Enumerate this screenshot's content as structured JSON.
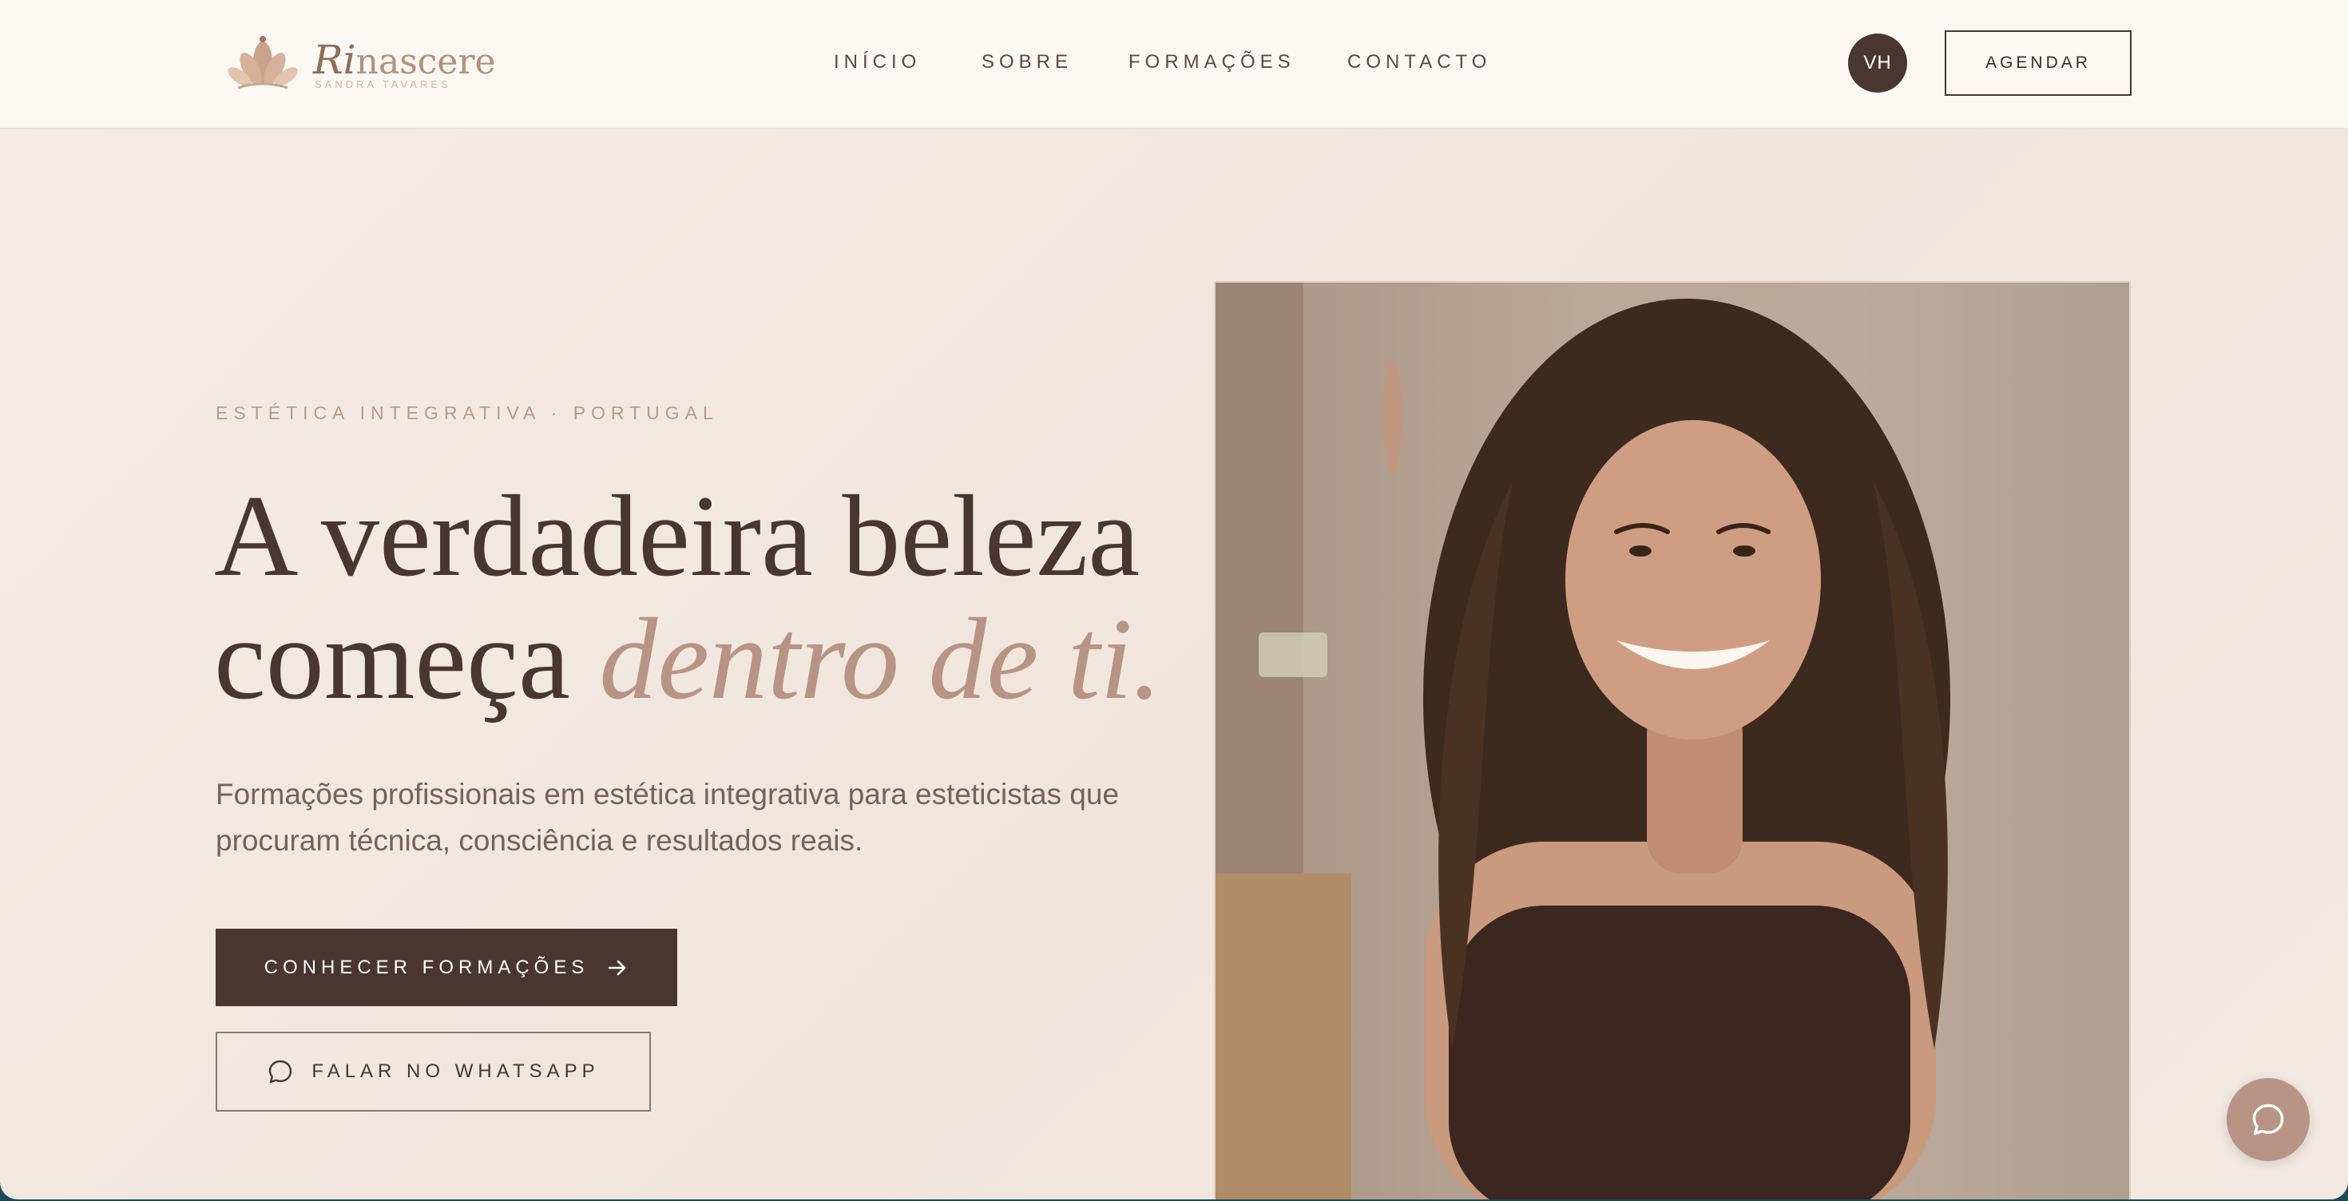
{
  "brand": {
    "logo_prefix": "Ri",
    "logo_suffix": "nascere",
    "logo_subtitle": "SANDRA TAVARES"
  },
  "nav": {
    "items": [
      "INÍCIO",
      "SOBRE",
      "FORMAÇÕES",
      "CONTACTO"
    ]
  },
  "header": {
    "avatar_initials": "VH",
    "cta_label": "AGENDAR"
  },
  "hero": {
    "eyebrow": "ESTÉTICA INTEGRATIVA · PORTUGAL",
    "headline_line1": "A verdadeira beleza",
    "headline_line2_start": "começa ",
    "headline_accent": "dentro de ti.",
    "lead": "Formações profissionais em estética integrativa para esteticistas que procuram técnica, consciência e resultados reais.",
    "primary_button": "CONHECER FORMAÇÕES",
    "secondary_button": "FALAR NO WHATSAPP"
  },
  "colors": {
    "brand_dark": "#4a3630",
    "accent_rose": "#b89484",
    "background_cream": "#f3ebe4",
    "navbar_bg": "#fbf7f3"
  },
  "icons": {
    "logo": "lotus-icon",
    "primary_button": "arrow-right-icon",
    "secondary_button": "chat-bubble-icon",
    "floating_button": "chat-bubble-icon"
  }
}
